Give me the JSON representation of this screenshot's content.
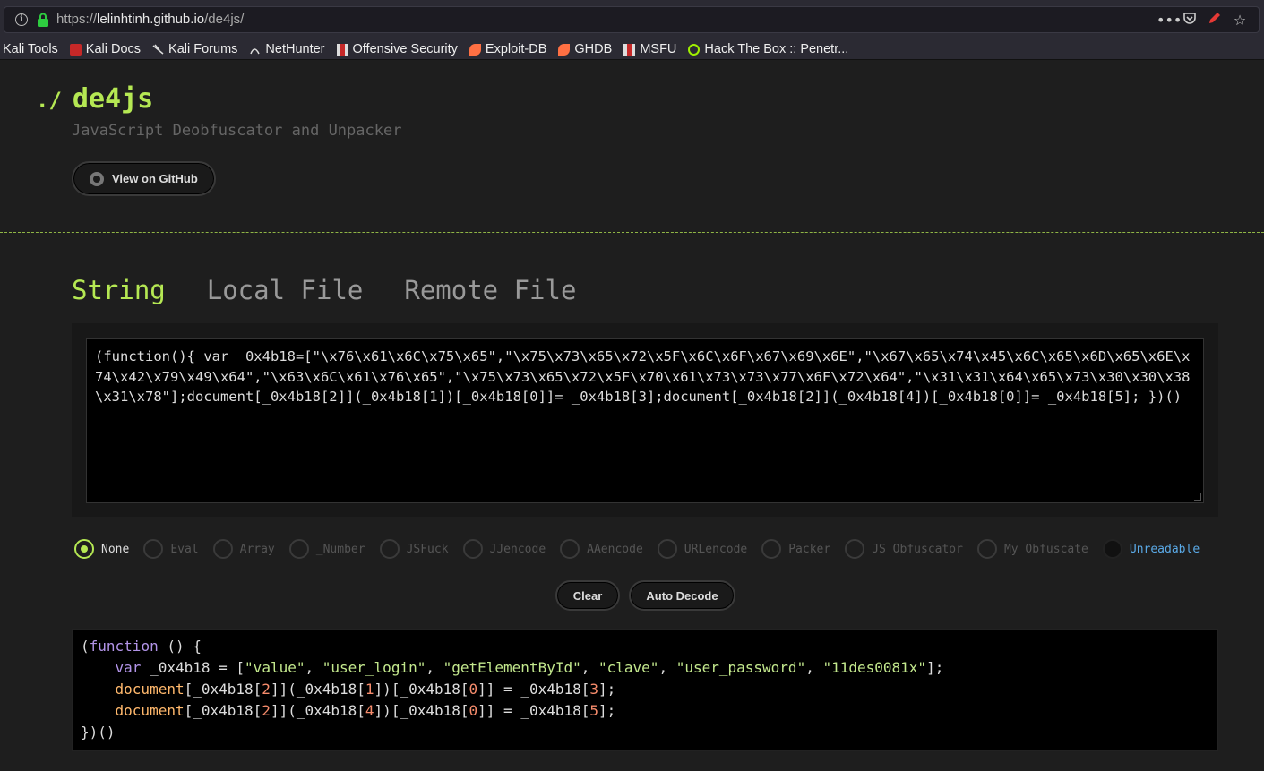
{
  "browser": {
    "url_prefix": "https://",
    "url_host": "lelinhtinh.github.io",
    "url_path": "/de4js/",
    "actions": [
      "more-icon",
      "pocket-icon",
      "pen-icon",
      "star-icon"
    ]
  },
  "bookmarks": [
    {
      "label": "Kali Tools",
      "icon": ""
    },
    {
      "label": "Kali Docs",
      "icon": "kali-docs-icon",
      "color": "#c62828"
    },
    {
      "label": "Kali Forums",
      "icon": "kali-dragon-icon",
      "color": "#ddd"
    },
    {
      "label": "NetHunter",
      "icon": "nethunter-icon",
      "color": "#ddd"
    },
    {
      "label": "Offensive Security",
      "icon": "offsec-icon",
      "color": "#c62828"
    },
    {
      "label": "Exploit-DB",
      "icon": "exploitdb-icon",
      "color": "#ff7043"
    },
    {
      "label": "GHDB",
      "icon": "ghdb-icon",
      "color": "#ff7043"
    },
    {
      "label": "MSFU",
      "icon": "msfu-icon",
      "color": "#c62828"
    },
    {
      "label": "Hack The Box :: Penetr...",
      "icon": "htb-icon",
      "color": "#9fef00"
    }
  ],
  "header": {
    "prefix": "./",
    "title": "de4js",
    "tagline": "JavaScript Deobfuscator and Unpacker",
    "github_button": "View on GitHub"
  },
  "tabs": [
    {
      "label": "String",
      "active": true
    },
    {
      "label": "Local File",
      "active": false
    },
    {
      "label": "Remote File",
      "active": false
    }
  ],
  "editor": {
    "value": "(function(){ var _0x4b18=[\"\\x76\\x61\\x6C\\x75\\x65\",\"\\x75\\x73\\x65\\x72\\x5F\\x6C\\x6F\\x67\\x69\\x6E\",\"\\x67\\x65\\x74\\x45\\x6C\\x65\\x6D\\x65\\x6E\\x74\\x42\\x79\\x49\\x64\",\"\\x63\\x6C\\x61\\x76\\x65\",\"\\x75\\x73\\x65\\x72\\x5F\\x70\\x61\\x73\\x73\\x77\\x6F\\x72\\x64\",\"\\x31\\x31\\x64\\x65\\x73\\x30\\x30\\x38\\x31\\x78\"];document[_0x4b18[2]](_0x4b18[1])[_0x4b18[0]]= _0x4b18[3];document[_0x4b18[2]](_0x4b18[4])[_0x4b18[0]]= _0x4b18[5]; })()"
  },
  "options": [
    {
      "label": "None",
      "selected": true
    },
    {
      "label": "Eval",
      "selected": false
    },
    {
      "label": "Array",
      "selected": false
    },
    {
      "label": "_Number",
      "selected": false
    },
    {
      "label": "JSFuck",
      "selected": false
    },
    {
      "label": "JJencode",
      "selected": false
    },
    {
      "label": "AAencode",
      "selected": false
    },
    {
      "label": "URLencode",
      "selected": false
    },
    {
      "label": "Packer",
      "selected": false
    },
    {
      "label": "JS Obfuscator",
      "selected": false
    },
    {
      "label": "My Obfuscate",
      "selected": false
    },
    {
      "label": "Unreadable",
      "selected": false,
      "link": true
    }
  ],
  "buttons": {
    "clear": "Clear",
    "auto_decode": "Auto Decode"
  },
  "output": {
    "lines": [
      "(function () {",
      "    var _0x4b18 = [\"value\", \"user_login\", \"getElementById\", \"clave\", \"user_password\", \"11des0081x\"];",
      "    document[_0x4b18[2]](_0x4b18[1])[_0x4b18[0]] = _0x4b18[3];",
      "    document[_0x4b18[2]](_0x4b18[4])[_0x4b18[0]] = _0x4b18[5];",
      "})()"
    ]
  },
  "colors": {
    "accent": "#b5e853",
    "link": "#5aa9e6",
    "background": "#1e1e1e"
  }
}
